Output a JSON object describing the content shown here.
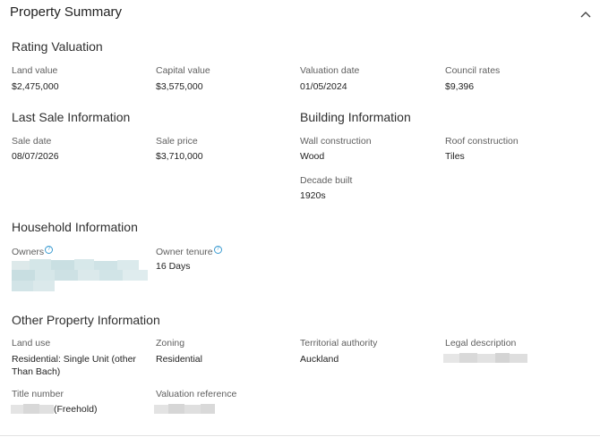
{
  "panel": {
    "title": "Property Summary"
  },
  "rating": {
    "title": "Rating Valuation",
    "land_label": "Land value",
    "land_value": "$2,475,000",
    "capital_label": "Capital value",
    "capital_value": "$3,575,000",
    "date_label": "Valuation date",
    "date_value": "01/05/2024",
    "rates_label": "Council rates",
    "rates_value": "$9,396"
  },
  "last_sale": {
    "title": "Last Sale Information",
    "date_label": "Sale date",
    "date_value": "08/07/2026",
    "price_label": "Sale price",
    "price_value": "$3,710,000"
  },
  "building": {
    "title": "Building Information",
    "wall_label": "Wall construction",
    "wall_value": "Wood",
    "roof_label": "Roof construction",
    "roof_value": "Tiles",
    "decade_label": "Decade built",
    "decade_value": "1920s"
  },
  "household": {
    "title": "Household Information",
    "owners_label": "Owners",
    "tenure_label": "Owner tenure",
    "tenure_value": "16 Days"
  },
  "other": {
    "title": "Other Property Information",
    "land_use_label": "Land use",
    "land_use_value": "Residential: Single Unit (other Than Bach)",
    "zoning_label": "Zoning",
    "zoning_value": "Residential",
    "authority_label": "Territorial authority",
    "authority_value": "Auckland",
    "legal_label": "Legal description",
    "title_number_label": "Title number",
    "title_number_suffix": "(Freehold)",
    "valuation_ref_label": "Valuation reference"
  },
  "icons": {
    "info": "info-icon",
    "collapse": "chevron-up-icon"
  },
  "colors": {
    "info_icon": "#3a9bd1",
    "redaction": "#cfe3e6"
  }
}
